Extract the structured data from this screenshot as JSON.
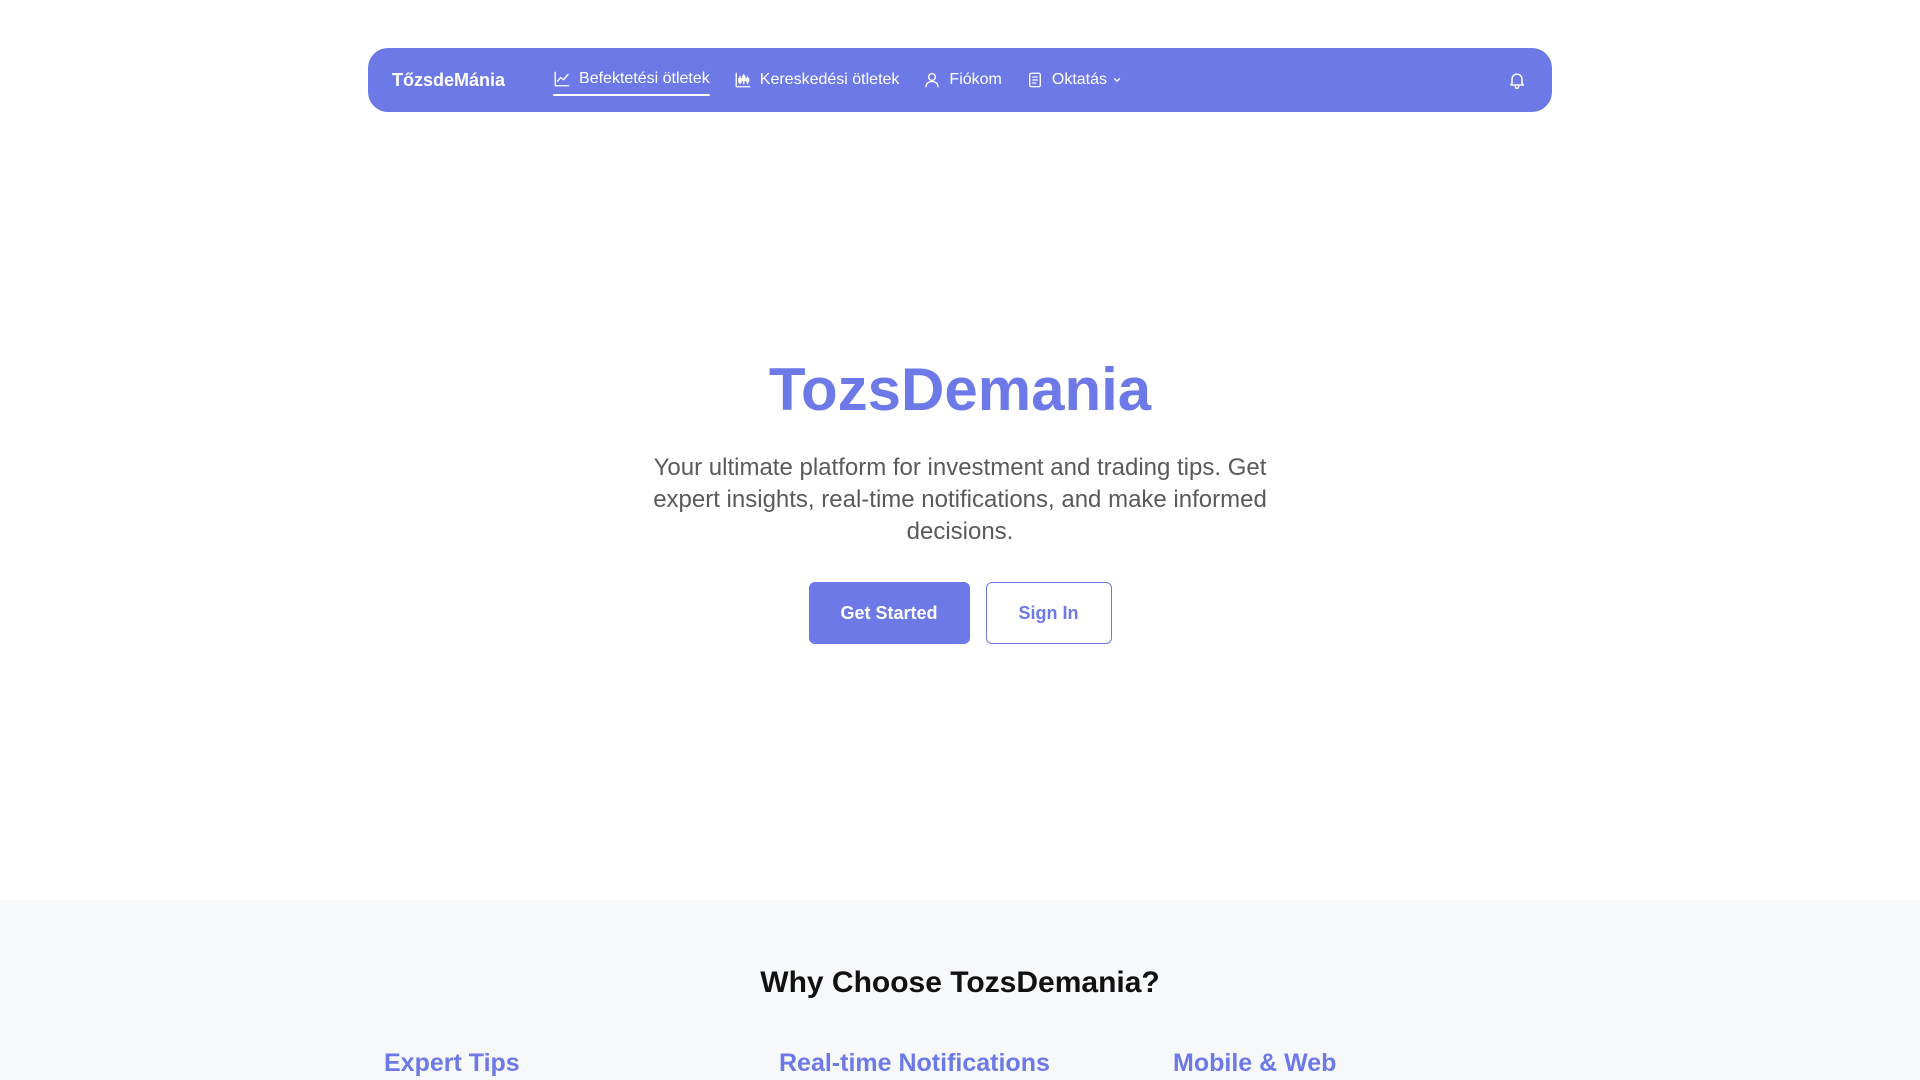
{
  "navbar": {
    "brand": "TőzsdeMánia",
    "items": [
      {
        "label": "Befektetési ötletek",
        "icon": "line-chart-icon",
        "active": true
      },
      {
        "label": "Kereskedési ötletek",
        "icon": "candlestick-icon",
        "active": false
      },
      {
        "label": "Fiókom",
        "icon": "user-icon",
        "active": false
      },
      {
        "label": "Oktatás",
        "icon": "document-icon",
        "active": false,
        "dropdown": true
      }
    ],
    "notification_icon": "bell-icon"
  },
  "hero": {
    "title": "TozsDemania",
    "subtitle": "Your ultimate platform for investment and trading tips. Get expert insights, real-time notifications, and make informed decisions.",
    "primary_button": "Get Started",
    "secondary_button": "Sign In"
  },
  "features": {
    "title": "Why Choose TozsDemania?",
    "items": [
      {
        "title": "Expert Tips"
      },
      {
        "title": "Real-time Notifications"
      },
      {
        "title": "Mobile & Web"
      }
    ]
  },
  "colors": {
    "accent": "#6c79e6",
    "section_bg": "#f7f8fa",
    "body_text": "#5a5a5a"
  }
}
